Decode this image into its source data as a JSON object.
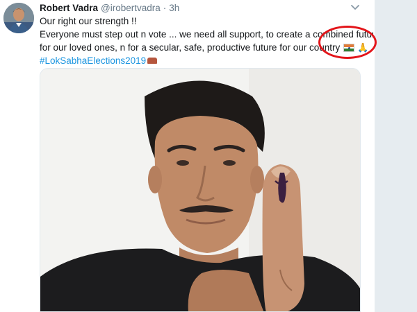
{
  "tweet": {
    "author": "Robert Vadra",
    "handle": "@irobertvadra",
    "separator": "·",
    "time": "3h",
    "lines": [
      "Our right our strength !!",
      "Everyone must step out n vote ... we need all support, to create a combined future",
      "for our loved ones, n for a secular, safe, productive future for our country"
    ],
    "hashtag": "#LokSabhaElections2019",
    "emojis": [
      "india-flag",
      "folded-hands",
      "ballot-finger"
    ]
  },
  "annotation": {
    "color": "#e3151a"
  },
  "colors": {
    "link": "#1b95e0",
    "muted": "#657786",
    "text": "#14171a"
  }
}
